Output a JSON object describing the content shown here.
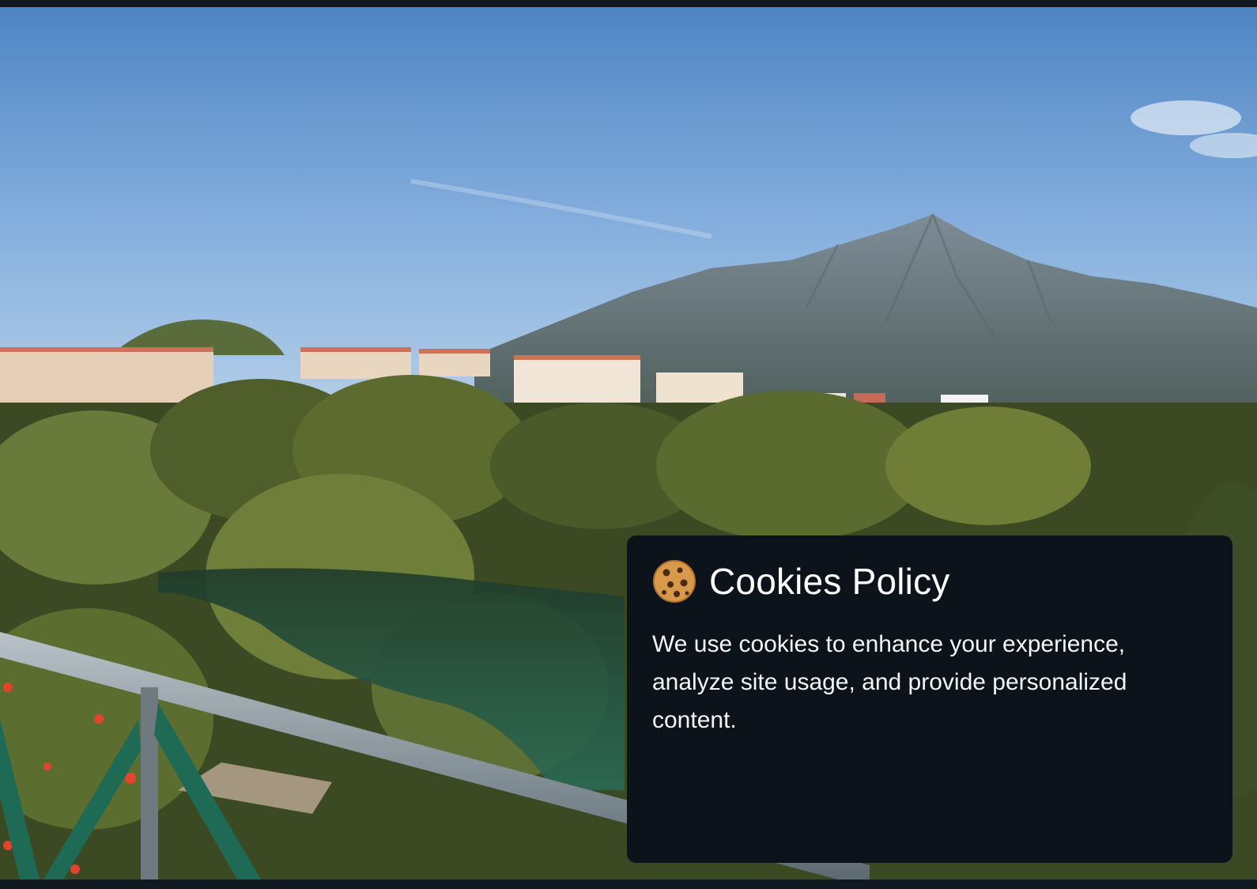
{
  "background": {
    "description_icon": "landscape-photo",
    "sky_color": "#6f9fcf",
    "mountain_color": "#6f7f8a"
  },
  "cookie_banner": {
    "icon": "cookie-icon",
    "title": "Cookies Policy",
    "message": "We use cookies to enhance your experience, analyze site usage, and provide personalized content.",
    "background_color": "#0d131b",
    "text_color": "#ffffff"
  }
}
